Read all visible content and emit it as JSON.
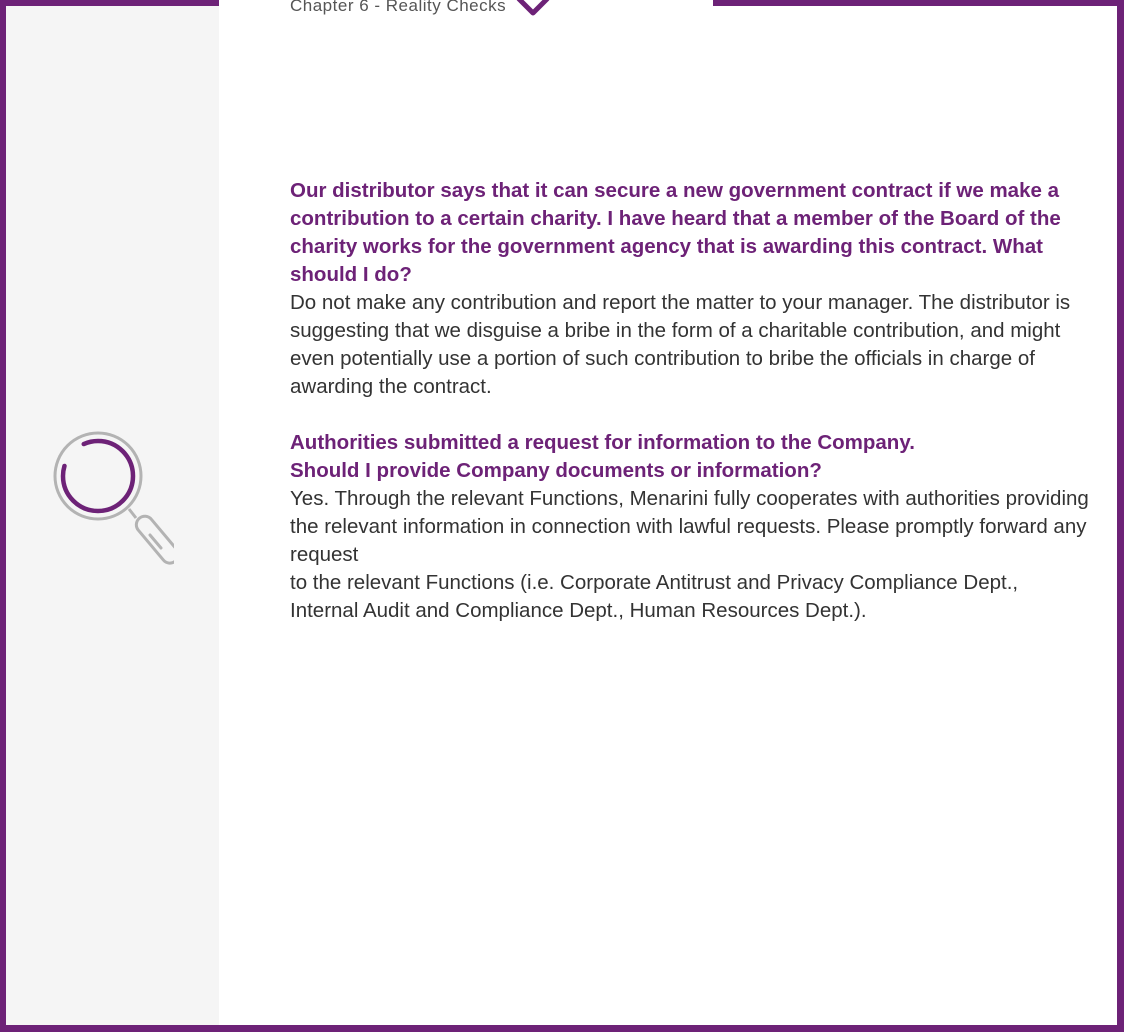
{
  "header": {
    "chapter_title": "Chapter 6 - Reality Checks"
  },
  "icons": {
    "search": "magnifying-glass-icon",
    "chevron": "chevron-down-icon"
  },
  "colors": {
    "accent": "#6d2277",
    "sidebar_bg": "#f5f5f5",
    "body_text": "#333333"
  },
  "qa": [
    {
      "question": "Our distributor says that it can secure a new government contract if we make a contribution to a certain charity. I have heard that a member of the Board of the charity works for the government agency that is awarding this contract. What should I do?",
      "answer": "Do not make any contribution and report the matter to your manager. The distributor is suggesting that we disguise a bribe in the form of a charitable contribution, and might even potentially use a portion of such contribution to bribe the officials in charge of awarding the contract."
    },
    {
      "question_line1": "Authorities submitted a request for information to the Company.",
      "question_line2": "Should I provide Company documents or information?",
      "answer_line1": "Yes. Through the relevant Functions, Menarini fully cooperates with authorities providing the relevant information in connection with lawful requests. Please promptly forward any request",
      "answer_line2": "to the relevant Functions (i.e. Corporate Antitrust and Privacy Compliance Dept., Internal Audit and Compliance Dept., Human Resources Dept.)."
    }
  ]
}
